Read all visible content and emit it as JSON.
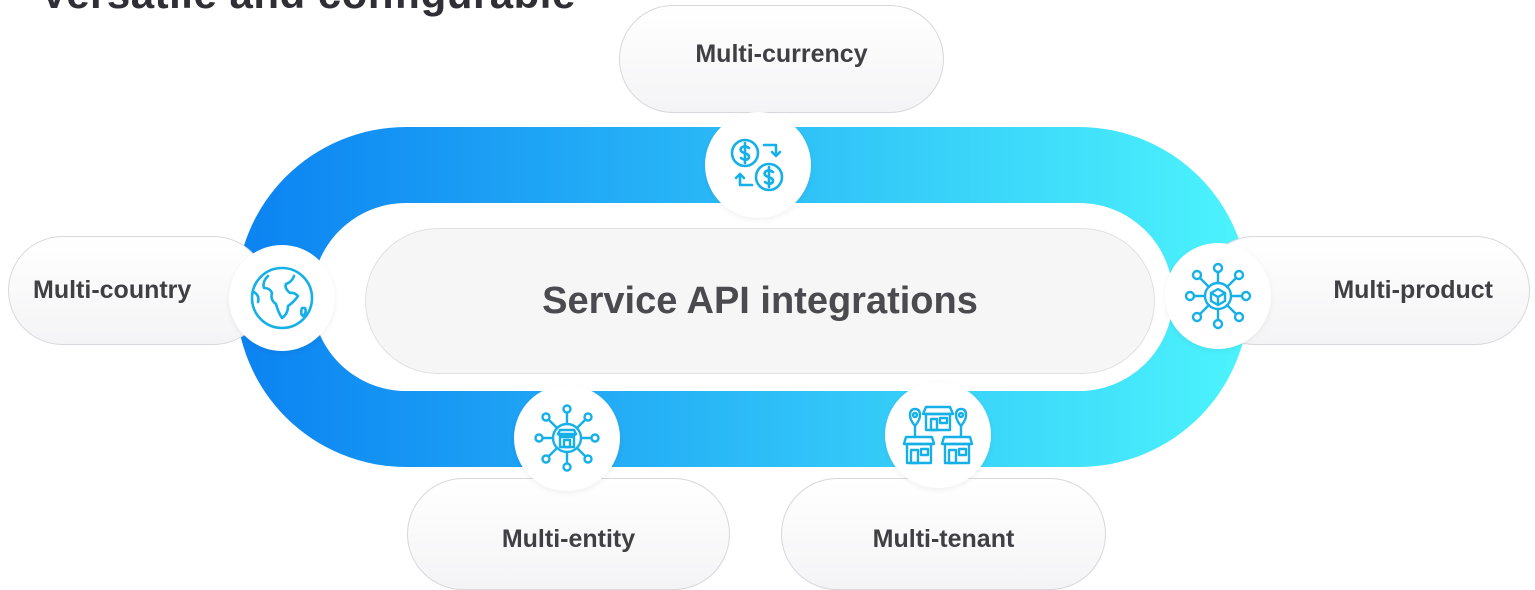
{
  "heading": "Versatile and configurable",
  "center_label": "Service API integrations",
  "nodes": {
    "currency": {
      "label": "Multi-currency",
      "icon": "currency-exchange-icon"
    },
    "country": {
      "label": "Multi-country",
      "icon": "globe-icon"
    },
    "product": {
      "label": "Multi-product",
      "icon": "product-network-icon"
    },
    "entity": {
      "label": "Multi-entity",
      "icon": "store-network-icon"
    },
    "tenant": {
      "label": "Multi-tenant",
      "icon": "multi-store-icon"
    }
  },
  "colors": {
    "ring_start": "#0b82f2",
    "ring_end": "#4cf4fc",
    "icon_stroke": "#16b0e8",
    "text": "#3f3f44",
    "pill_border": "#d8d8dc"
  }
}
